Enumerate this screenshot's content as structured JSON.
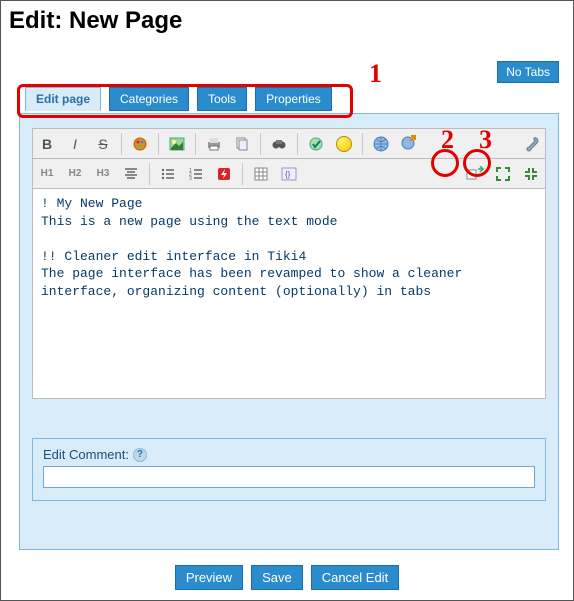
{
  "title": "Edit: New Page",
  "no_tabs_label": "No Tabs",
  "tabs": [
    {
      "label": "Edit page",
      "active": true
    },
    {
      "label": "Categories",
      "active": false
    },
    {
      "label": "Tools",
      "active": false
    },
    {
      "label": "Properties",
      "active": false
    }
  ],
  "annotations": {
    "n1": "1",
    "n2": "2",
    "n3": "3"
  },
  "editor_text": "! My New Page\nThis is a new page using the text mode\n\n!! Cleaner edit interface in Tiki4\nThe page interface has been revamped to show a cleaner interface, organizing content (optionally) in tabs",
  "comment": {
    "label": "Edit Comment:",
    "value": ""
  },
  "actions": {
    "preview": "Preview",
    "save": "Save",
    "cancel": "Cancel Edit"
  },
  "toolbar_row1": {
    "bold": "B",
    "italic": "I",
    "strike": "S"
  },
  "toolbar_row2": {
    "h1": "H1",
    "h2": "H2",
    "h3": "H3"
  }
}
